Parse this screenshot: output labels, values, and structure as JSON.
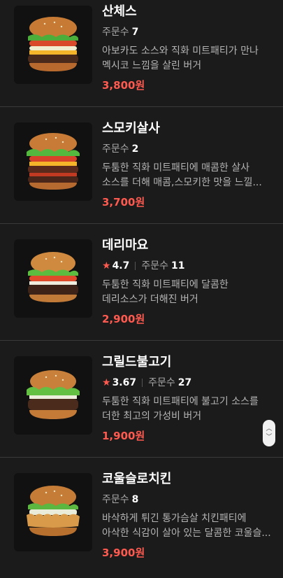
{
  "menu": {
    "items": [
      {
        "name": "산체스",
        "orders_label": "주문수",
        "orders": "7",
        "rating": null,
        "description": "아보카도 소스와 직화 미트패티가 만나 멕시코 느낌을 살린 버거",
        "price": "3,800원",
        "image_icon": "burger-image"
      },
      {
        "name": "스모키살사",
        "orders_label": "주문수",
        "orders": "2",
        "rating": null,
        "description": "두툼한 직화 미트패티에 매콤한 살사 소스를 더해 매콤,스모키한 맛을 느낄...",
        "price": "3,700원",
        "image_icon": "burger-image"
      },
      {
        "name": "데리마요",
        "orders_label": "주문수",
        "orders": "11",
        "rating": "4.7",
        "description": "두툼한 직화 미트패티에 달콤한 데리소스가 더해진 버거",
        "price": "2,900원",
        "image_icon": "burger-image"
      },
      {
        "name": "그릴드불고기",
        "orders_label": "주문수",
        "orders": "27",
        "rating": "3.67",
        "description": "두툼한 직화 미트패티에 불고기 소스를 더한 최고의 가성비 버거",
        "price": "1,900원",
        "image_icon": "burger-image"
      },
      {
        "name": "코울슬로치킨",
        "orders_label": "주문수",
        "orders": "8",
        "rating": null,
        "description": "바삭하게 튀긴 통가슴살 치킨패티에 아삭한 식감이 살아 있는 달콤한 코울슬...",
        "price": "3,900원",
        "image_icon": "chicken-burger-image"
      }
    ]
  },
  "scroll_control": {
    "up_icon": "chevron-up-icon",
    "down_icon": "chevron-down-icon"
  },
  "colors": {
    "background": "#1b1b1b",
    "price": "#ff5a4f",
    "star": "#ff5a4f"
  }
}
